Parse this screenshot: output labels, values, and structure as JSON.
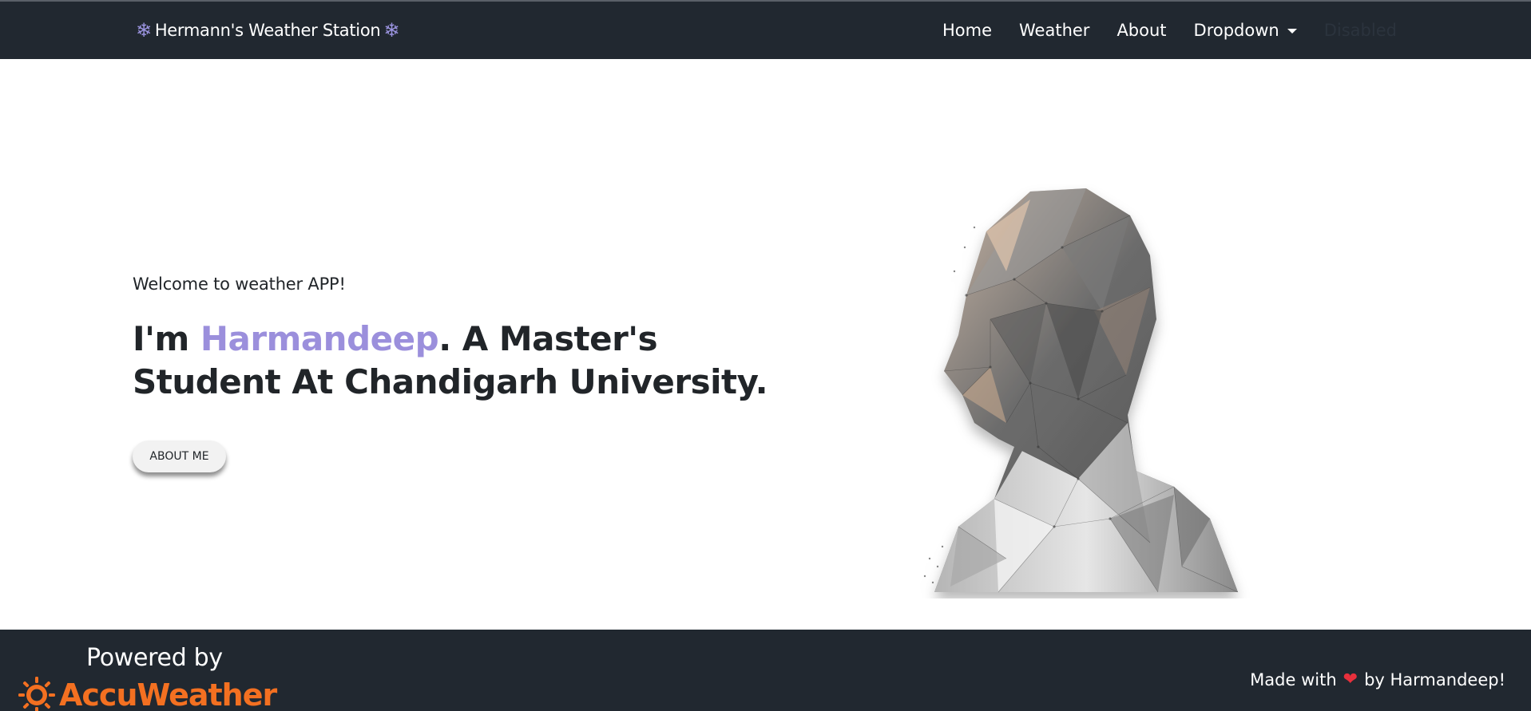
{
  "navbar": {
    "brand": "Hermann's Weather Station",
    "brand_icon": "snowflake-icon",
    "links": [
      "Home",
      "Weather",
      "About",
      "Dropdown",
      "Disabled"
    ]
  },
  "hero": {
    "welcome": "Welcome to weather APP!",
    "headline_prefix": "I'm ",
    "headline_name": "Harmandeep",
    "headline_suffix": ". A Master's Student At Chandigarh University.",
    "button_label": "ABOUT ME"
  },
  "footer": {
    "powered_by": "Powered by",
    "provider": "AccuWeather",
    "made_with_prefix": "Made with",
    "made_with_suffix": "by Harmandeep!"
  },
  "colors": {
    "navbar_bg": "#212830",
    "accent": "#9b8fdc",
    "accuweather": "#f37021",
    "heart": "#e8303c"
  }
}
